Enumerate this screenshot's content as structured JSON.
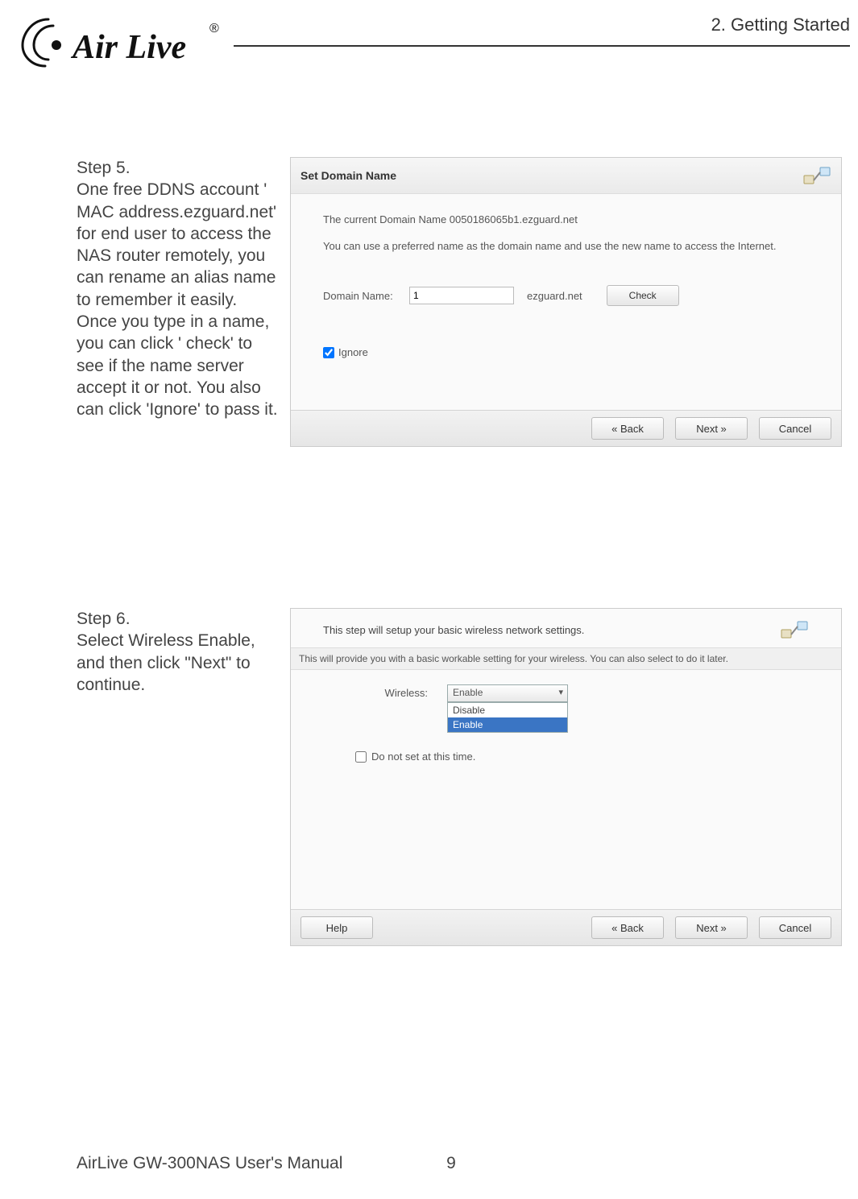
{
  "chapter": "2. Getting Started",
  "logo_text": "Air Live",
  "step5": {
    "title": "Step 5.",
    "body": "One free DDNS account ' MAC address.ezguard.net' for end user to access the NAS router remotely, you can rename an alias name to remember it easily. Once you type in a name, you can click ' check' to see if the name server accept it or not. You also can click 'Ignore' to pass it.",
    "panel": {
      "header": "Set Domain Name",
      "current": "The current Domain Name 0050186065b1.ezguard.net",
      "prefer": "You can use a preferred name as the domain name and use the new name to access the Internet.",
      "domain_label": "Domain Name:",
      "domain_value": "1",
      "domain_suffix": "ezguard.net",
      "check_btn": "Check",
      "ignore_label": "Ignore",
      "back_btn": "« Back",
      "next_btn": "Next »",
      "cancel_btn": "Cancel"
    }
  },
  "step6": {
    "title": "Step 6.",
    "body": "Select Wireless Enable, and then click \"Next\" to continue.",
    "panel": {
      "head": "This step will setup your basic wireless network settings.",
      "sub": "This will provide you with a basic workable setting for your wireless. You can also select to do it later.",
      "wireless_label": "Wireless:",
      "selected": "Enable",
      "options": [
        "Disable",
        "Enable"
      ],
      "skip_label": "Do not set at this time.",
      "help_btn": "Help",
      "back_btn": "« Back",
      "next_btn": "Next »",
      "cancel_btn": "Cancel"
    }
  },
  "footer_manual": "AirLive GW-300NAS User's Manual",
  "footer_page": "9"
}
